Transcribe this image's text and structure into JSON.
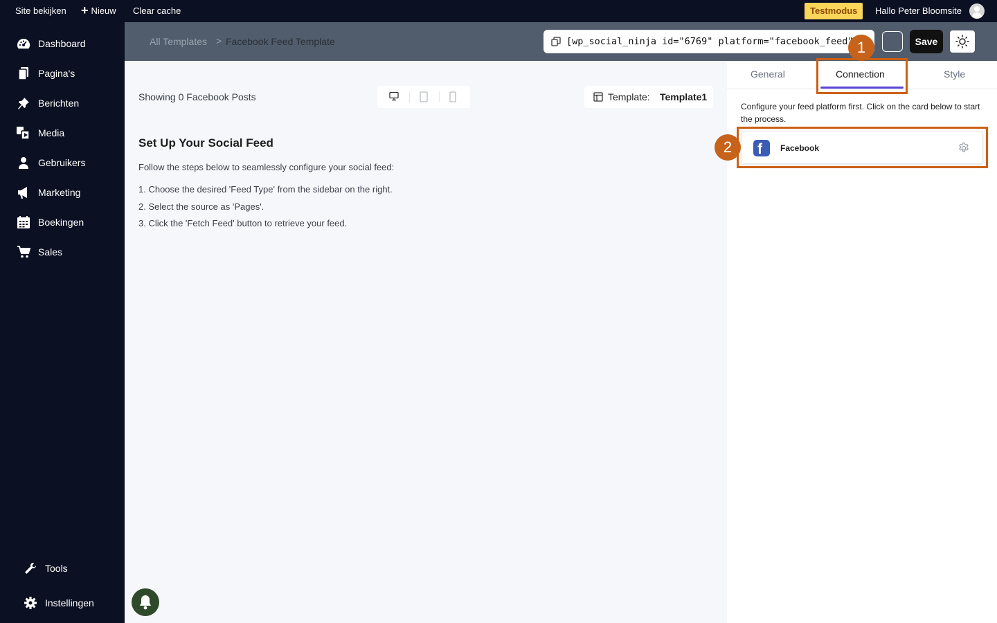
{
  "adminbar": {
    "view_site": "Site bekijken",
    "new": "Nieuw",
    "clear_cache": "Clear cache",
    "test_mode": "Testmodus",
    "greeting": "Hallo Peter Bloomsite"
  },
  "sidebar": {
    "items": [
      {
        "label": "Dashboard",
        "icon": "dashboard-icon"
      },
      {
        "label": "Pagina's",
        "icon": "pages-icon"
      },
      {
        "label": "Berichten",
        "icon": "pin-icon"
      },
      {
        "label": "Media",
        "icon": "media-icon"
      },
      {
        "label": "Gebruikers",
        "icon": "users-icon"
      },
      {
        "label": "Marketing",
        "icon": "megaphone-icon"
      },
      {
        "label": "Boekingen",
        "icon": "calendar-icon"
      },
      {
        "label": "Sales",
        "icon": "cart-icon"
      }
    ],
    "bottom": [
      {
        "label": "Tools",
        "icon": "wrench-icon"
      },
      {
        "label": "Instellingen",
        "icon": "gear-icon"
      }
    ]
  },
  "header": {
    "breadcrumb_root": "All Templates",
    "breadcrumb_separator": ">",
    "breadcrumb_current": "Facebook Feed Template",
    "shortcode": "[wp_social_ninja id=\"6769\" platform=\"facebook_feed\"]",
    "save_label": "Save"
  },
  "preview": {
    "showing": "Showing 0 Facebook Posts",
    "template_label": "Template:",
    "template_value": "Template1",
    "setup_title": "Set Up Your Social Feed",
    "setup_desc": "Follow the steps below to seamlessly configure your social feed:",
    "steps": [
      "1. Choose the desired 'Feed Type' from the sidebar on the right.",
      "2. Select the source as 'Pages'.",
      "3. Click the 'Fetch Feed' button to retrieve your feed."
    ]
  },
  "panel": {
    "tabs": [
      "General",
      "Connection",
      "Style"
    ],
    "active_tab": "Connection",
    "note": "Configure your feed platform first. Click on the card below to start the process.",
    "platform_card": {
      "name": "Facebook",
      "logo_letter": "f"
    }
  },
  "annotations": {
    "badges": [
      "1",
      "2"
    ],
    "color": "#cc5f14"
  },
  "colors": {
    "sidebar_bg": "#0b1122",
    "header_bg": "#515d6c",
    "accent_tab": "#5b46d6",
    "facebook_blue": "#3b5bb5",
    "test_mode_bg": "#fbd55a"
  }
}
